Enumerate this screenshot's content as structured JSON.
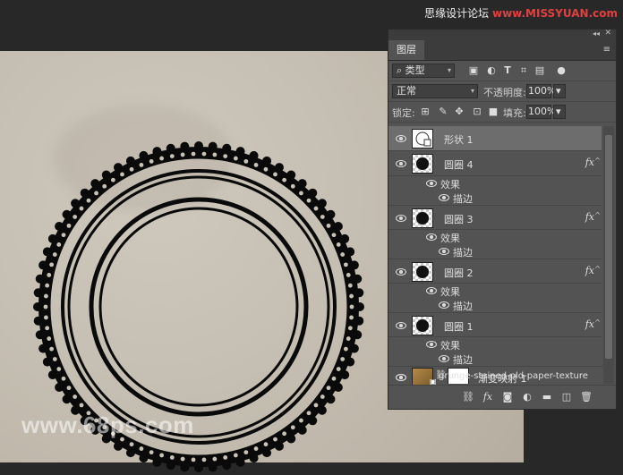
{
  "watermarks": {
    "top": "思缘设计论坛 ",
    "top_url": "www.MISSYUAN.com",
    "bottom": "www.68ps.com"
  },
  "panel": {
    "tab": "图层",
    "filter_kind": "类型",
    "blend_mode": "正常",
    "opacity_label": "不透明度:",
    "opacity_value": "100%",
    "lock_label": "锁定:",
    "fill_label": "填充:",
    "fill_value": "100%",
    "fx_symbol": "fx",
    "effects_label": "效果",
    "stroke_label": "描边"
  },
  "layers": [
    {
      "name": "形状 1",
      "selected": true
    },
    {
      "name": "圆圈 4",
      "has_fx": true
    },
    {
      "name": "圆圈 3",
      "has_fx": true
    },
    {
      "name": "圆圈 2",
      "has_fx": true
    },
    {
      "name": "圆圈 1",
      "has_fx": true
    },
    {
      "name": "渐变映射 1"
    },
    {
      "name": "grunge-stained-old-paper-texture"
    }
  ],
  "icons": {
    "filter": [
      "image-filter-icon",
      "adjustment-filter-icon",
      "text-filter-icon",
      "shape-filter-icon",
      "smart-object-filter-icon",
      "filter-toggle-icon"
    ],
    "lock": [
      "lock-pixels-icon",
      "lock-paint-icon",
      "lock-position-icon",
      "lock-artboard-icon",
      "lock-all-icon"
    ],
    "bottom": [
      "link-layers-icon",
      "add-style-icon",
      "add-mask-icon",
      "new-adjustment-icon",
      "new-group-icon",
      "new-layer-icon",
      "delete-layer-icon"
    ]
  },
  "colors": {
    "panel_bg": "#535353",
    "selected_row": "#6d6d6d",
    "paper": "#c9c2b6",
    "stamp": "#0a0a0a"
  }
}
